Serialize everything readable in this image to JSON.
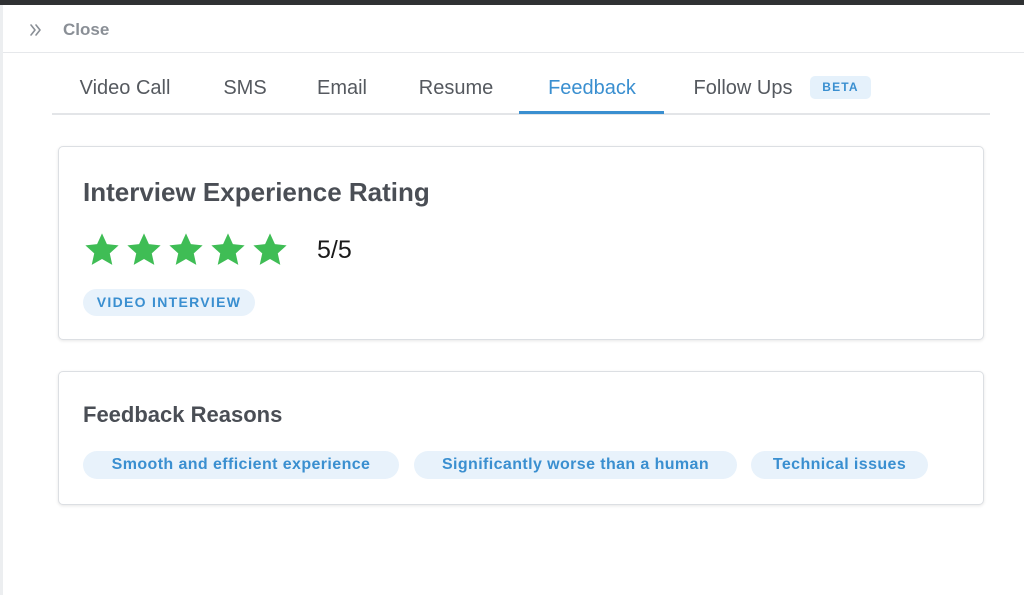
{
  "header": {
    "close_label": "Close",
    "collapse_icon": "double-chevron-right-icon"
  },
  "tabs": [
    {
      "label": "Video Call",
      "active": false
    },
    {
      "label": "SMS",
      "active": false
    },
    {
      "label": "Email",
      "active": false
    },
    {
      "label": "Resume",
      "active": false
    },
    {
      "label": "Feedback",
      "active": true
    },
    {
      "label": "Follow Ups",
      "active": false,
      "badge": "BETA"
    }
  ],
  "rating_card": {
    "title": "Interview Experience Rating",
    "rating": 5,
    "max_rating": 5,
    "rating_text": "5/5",
    "star_icon": "star-icon",
    "star_color": "#3fbd55",
    "type_chip": "VIDEO INTERVIEW"
  },
  "reasons_card": {
    "title": "Feedback Reasons",
    "reasons": [
      "Smooth and efficient experience",
      "Significantly worse than a human",
      "Technical issues"
    ]
  },
  "colors": {
    "accent": "#3a8fd0",
    "chip_bg": "#e8f2fb",
    "star": "#3fbd55"
  }
}
